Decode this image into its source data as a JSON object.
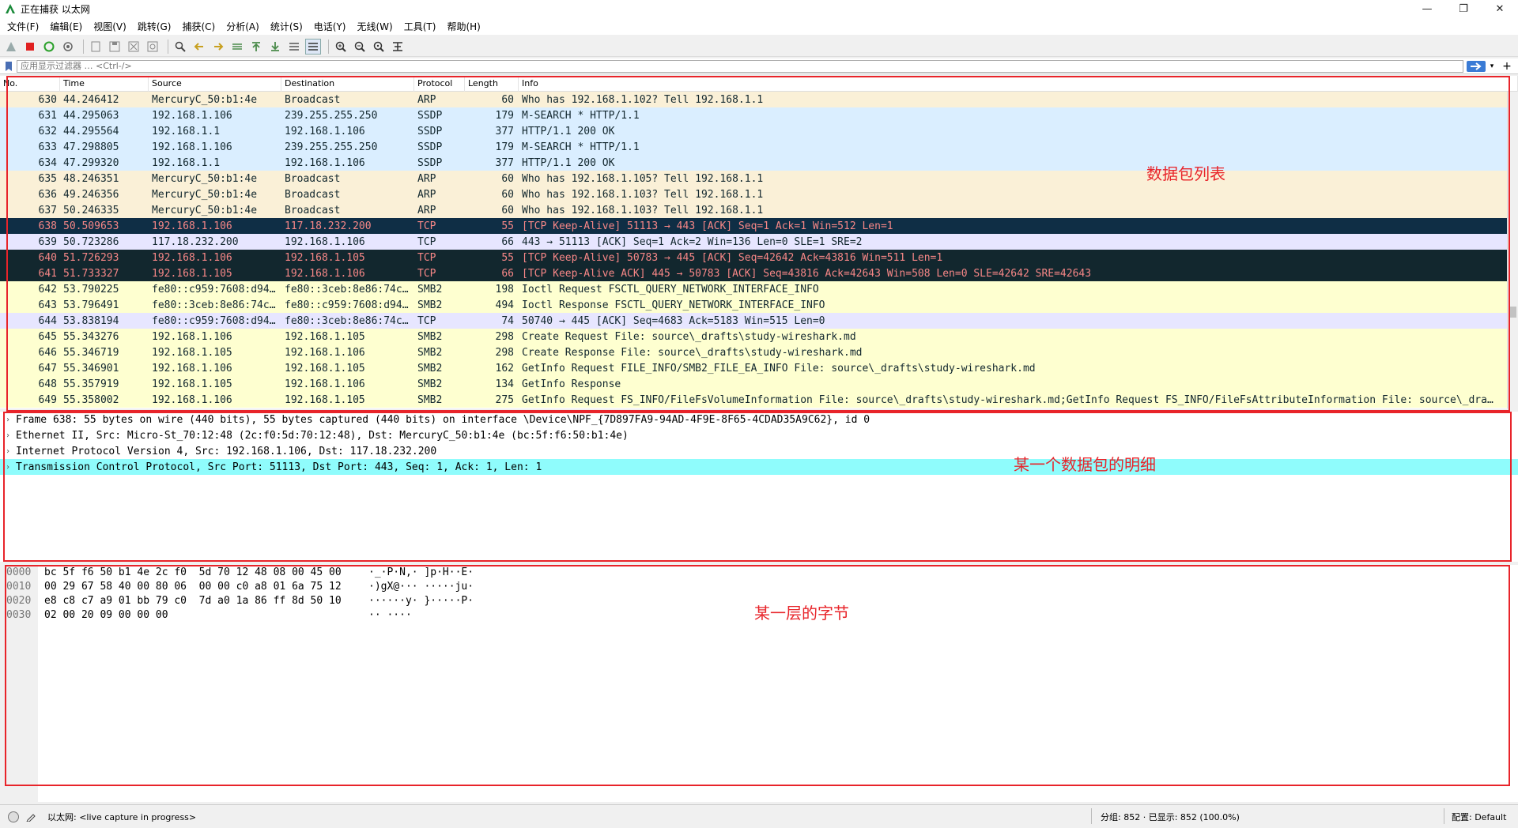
{
  "window": {
    "title": "正在捕获 以太网",
    "controls": [
      "—",
      "❐",
      "✕"
    ]
  },
  "menu": [
    "文件(F)",
    "编辑(E)",
    "视图(V)",
    "跳转(G)",
    "捕获(C)",
    "分析(A)",
    "统计(S)",
    "电话(Y)",
    "无线(W)",
    "工具(T)",
    "帮助(H)"
  ],
  "filter": {
    "placeholder": "应用显示过滤器 … <Ctrl-/>",
    "apply_icon": "arrow-right-icon"
  },
  "packet_list": {
    "columns": [
      "No.",
      "Time",
      "Source",
      "Destination",
      "Protocol",
      "Length",
      "Info"
    ],
    "rows": [
      {
        "no": "630",
        "time": "44.246412",
        "src": "MercuryC_50:b1:4e",
        "dst": "Broadcast",
        "proto": "ARP",
        "len": "60",
        "info": "Who has 192.168.1.102? Tell 192.168.1.1",
        "bg": "#faf0d7",
        "fg": "#12272e"
      },
      {
        "no": "631",
        "time": "44.295063",
        "src": "192.168.1.106",
        "dst": "239.255.255.250",
        "proto": "SSDP",
        "len": "179",
        "info": "M-SEARCH * HTTP/1.1",
        "bg": "#daeeff",
        "fg": "#12272e"
      },
      {
        "no": "632",
        "time": "44.295564",
        "src": "192.168.1.1",
        "dst": "192.168.1.106",
        "proto": "SSDP",
        "len": "377",
        "info": "HTTP/1.1 200 OK",
        "bg": "#daeeff",
        "fg": "#12272e"
      },
      {
        "no": "633",
        "time": "47.298805",
        "src": "192.168.1.106",
        "dst": "239.255.255.250",
        "proto": "SSDP",
        "len": "179",
        "info": "M-SEARCH * HTTP/1.1",
        "bg": "#daeeff",
        "fg": "#12272e"
      },
      {
        "no": "634",
        "time": "47.299320",
        "src": "192.168.1.1",
        "dst": "192.168.1.106",
        "proto": "SSDP",
        "len": "377",
        "info": "HTTP/1.1 200 OK",
        "bg": "#daeeff",
        "fg": "#12272e"
      },
      {
        "no": "635",
        "time": "48.246351",
        "src": "MercuryC_50:b1:4e",
        "dst": "Broadcast",
        "proto": "ARP",
        "len": "60",
        "info": "Who has 192.168.1.105? Tell 192.168.1.1",
        "bg": "#faf0d7",
        "fg": "#12272e"
      },
      {
        "no": "636",
        "time": "49.246356",
        "src": "MercuryC_50:b1:4e",
        "dst": "Broadcast",
        "proto": "ARP",
        "len": "60",
        "info": "Who has 192.168.1.103? Tell 192.168.1.1",
        "bg": "#faf0d7",
        "fg": "#12272e"
      },
      {
        "no": "637",
        "time": "50.246335",
        "src": "MercuryC_50:b1:4e",
        "dst": "Broadcast",
        "proto": "ARP",
        "len": "60",
        "info": "Who has 192.168.1.103? Tell 192.168.1.1",
        "bg": "#faf0d7",
        "fg": "#12272e"
      },
      {
        "no": "638",
        "time": "50.509653",
        "src": "192.168.1.106",
        "dst": "117.18.232.200",
        "proto": "TCP",
        "len": "55",
        "info": "[TCP Keep-Alive] 51113 → 443 [ACK] Seq=1 Ack=1 Win=512 Len=1",
        "bg": "#0f2e45",
        "fg": "#f78787"
      },
      {
        "no": "639",
        "time": "50.723286",
        "src": "117.18.232.200",
        "dst": "192.168.1.106",
        "proto": "TCP",
        "len": "66",
        "info": "443 → 51113 [ACK] Seq=1 Ack=2 Win=136 Len=0 SLE=1 SRE=2",
        "bg": "#e7e6ff",
        "fg": "#12272e"
      },
      {
        "no": "640",
        "time": "51.726293",
        "src": "192.168.1.106",
        "dst": "192.168.1.105",
        "proto": "TCP",
        "len": "55",
        "info": "[TCP Keep-Alive] 50783 → 445 [ACK] Seq=42642 Ack=43816 Win=511 Len=1",
        "bg": "#12272e",
        "fg": "#f78787"
      },
      {
        "no": "641",
        "time": "51.733327",
        "src": "192.168.1.105",
        "dst": "192.168.1.106",
        "proto": "TCP",
        "len": "66",
        "info": "[TCP Keep-Alive ACK] 445 → 50783 [ACK] Seq=43816 Ack=42643 Win=508 Len=0 SLE=42642 SRE=42643",
        "bg": "#12272e",
        "fg": "#f78787"
      },
      {
        "no": "642",
        "time": "53.790225",
        "src": "fe80::c959:7608:d94…",
        "dst": "fe80::3ceb:8e86:74c…",
        "proto": "SMB2",
        "len": "198",
        "info": "Ioctl Request FSCTL_QUERY_NETWORK_INTERFACE_INFO",
        "bg": "#feffd0",
        "fg": "#12272e"
      },
      {
        "no": "643",
        "time": "53.796491",
        "src": "fe80::3ceb:8e86:74c…",
        "dst": "fe80::c959:7608:d94…",
        "proto": "SMB2",
        "len": "494",
        "info": "Ioctl Response FSCTL_QUERY_NETWORK_INTERFACE_INFO",
        "bg": "#feffd0",
        "fg": "#12272e"
      },
      {
        "no": "644",
        "time": "53.838194",
        "src": "fe80::c959:7608:d94…",
        "dst": "fe80::3ceb:8e86:74c…",
        "proto": "TCP",
        "len": "74",
        "info": "50740 → 445 [ACK] Seq=4683 Ack=5183 Win=515 Len=0",
        "bg": "#e7e6ff",
        "fg": "#12272e"
      },
      {
        "no": "645",
        "time": "55.343276",
        "src": "192.168.1.106",
        "dst": "192.168.1.105",
        "proto": "SMB2",
        "len": "298",
        "info": "Create Request File: source\\_drafts\\study-wireshark.md",
        "bg": "#feffd0",
        "fg": "#12272e"
      },
      {
        "no": "646",
        "time": "55.346719",
        "src": "192.168.1.105",
        "dst": "192.168.1.106",
        "proto": "SMB2",
        "len": "298",
        "info": "Create Response File: source\\_drafts\\study-wireshark.md",
        "bg": "#feffd0",
        "fg": "#12272e"
      },
      {
        "no": "647",
        "time": "55.346901",
        "src": "192.168.1.106",
        "dst": "192.168.1.105",
        "proto": "SMB2",
        "len": "162",
        "info": "GetInfo Request FILE_INFO/SMB2_FILE_EA_INFO File: source\\_drafts\\study-wireshark.md",
        "bg": "#feffd0",
        "fg": "#12272e"
      },
      {
        "no": "648",
        "time": "55.357919",
        "src": "192.168.1.105",
        "dst": "192.168.1.106",
        "proto": "SMB2",
        "len": "134",
        "info": "GetInfo Response",
        "bg": "#feffd0",
        "fg": "#12272e"
      },
      {
        "no": "649",
        "time": "55.358002",
        "src": "192.168.1.106",
        "dst": "192.168.1.105",
        "proto": "SMB2",
        "len": "275",
        "info": "GetInfo Request FS_INFO/FileFsVolumeInformation File: source\\_drafts\\study-wireshark.md;GetInfo Request FS_INFO/FileFsAttributeInformation File: source\\_dra…",
        "bg": "#feffd0",
        "fg": "#12272e"
      }
    ]
  },
  "detail": {
    "rows": [
      {
        "text": "Frame 638: 55 bytes on wire (440 bits), 55 bytes captured (440 bits) on interface \\Device\\NPF_{7D897FA9-94AD-4F9E-8F65-4CDAD35A9C62}, id 0",
        "selected": false
      },
      {
        "text": "Ethernet II, Src: Micro-St_70:12:48 (2c:f0:5d:70:12:48), Dst: MercuryC_50:b1:4e (bc:5f:f6:50:b1:4e)",
        "selected": false
      },
      {
        "text": "Internet Protocol Version 4, Src: 192.168.1.106, Dst: 117.18.232.200",
        "selected": false
      },
      {
        "text": "Transmission Control Protocol, Src Port: 51113, Dst Port: 443, Seq: 1, Ack: 1, Len: 1",
        "selected": true
      }
    ],
    "selected_color": "#8ffcfc"
  },
  "bytes": {
    "rows": [
      {
        "offset": "0000",
        "hex": "bc 5f f6 50 b1 4e 2c f0  5d 70 12 48 08 00 45 00",
        "ascii": "·_·P·N,· ]p·H··E·"
      },
      {
        "offset": "0010",
        "hex": "00 29 67 58 40 00 80 06  00 00 c0 a8 01 6a 75 12",
        "ascii": "·)gX@··· ·····ju·"
      },
      {
        "offset": "0020",
        "hex": "e8 c8 c7 a9 01 bb 79 c0  7d a0 1a 86 ff 8d 50 10",
        "ascii": "······y· }·····P·"
      },
      {
        "offset": "0030",
        "hex": "02 00 20 09 00 00 00",
        "ascii": "·· ····"
      }
    ]
  },
  "annotations": {
    "packet_list": "数据包列表",
    "detail": "某一个数据包的明细",
    "bytes": "某一层的字节",
    "color": "#e8242a"
  },
  "status": {
    "interface": "以太网: <live capture in progress>",
    "counts": "分组: 852 · 已显示: 852 (100.0%)",
    "profile": "配置: Default"
  }
}
